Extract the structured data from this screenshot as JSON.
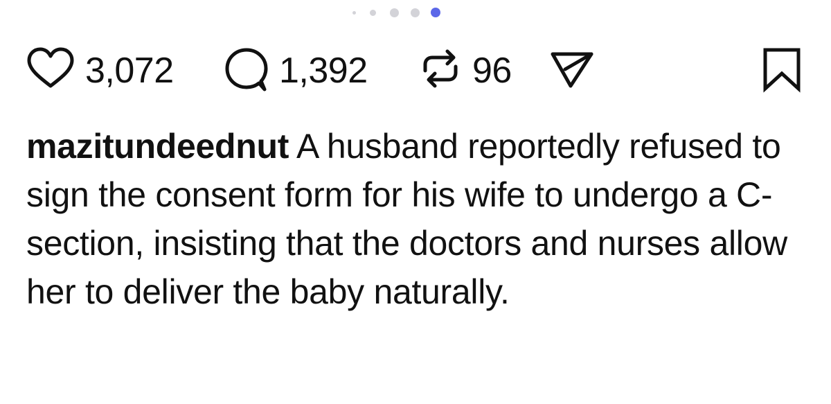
{
  "carousel": {
    "dot_count": 5,
    "active_index": 4,
    "active_color": "#5b67e8",
    "inactive_color": "#d3d3d8"
  },
  "actions": {
    "likes": {
      "icon": "heart-icon",
      "count": "3,072"
    },
    "comments": {
      "icon": "comment-bubble-icon",
      "count": "1,392"
    },
    "reposts": {
      "icon": "repost-icon",
      "count": "96"
    },
    "share": {
      "icon": "send-icon"
    },
    "save": {
      "icon": "bookmark-icon"
    }
  },
  "caption": {
    "username": "mazitundeednut",
    "text": " A husband reportedly refused to sign the consent form for his wife to undergo a C-section, insisting that the doctors and nurses allow her to deliver the baby naturally."
  },
  "colors": {
    "text": "#111111",
    "background": "#ffffff"
  }
}
